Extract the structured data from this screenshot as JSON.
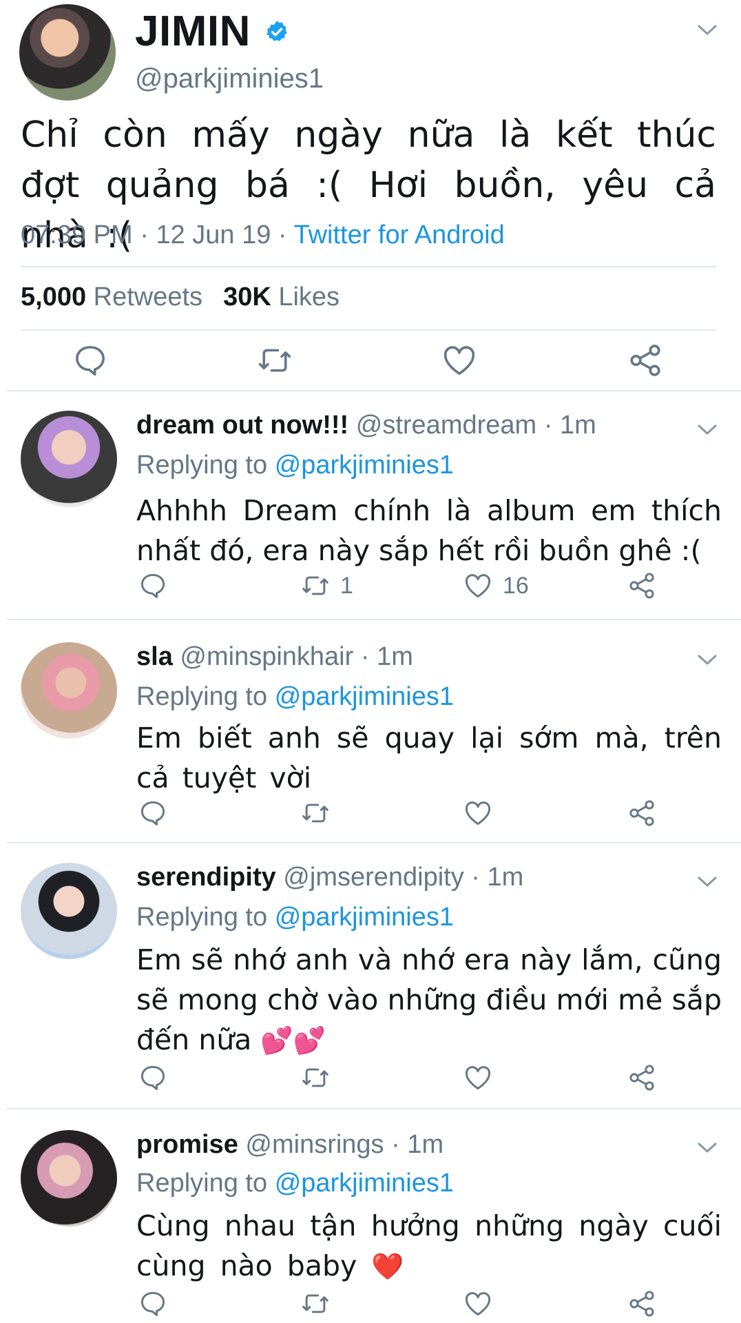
{
  "main_tweet": {
    "name": "JIMIN",
    "handle": "@parkjiminies1",
    "text": "Chỉ còn mấy ngày nữa là kết thúc đợt quảng bá :( Hơi buồn, yêu cả nhà :(",
    "time": "07:39 PM",
    "sep1": " · ",
    "date": "12 Jun 19",
    "sep2": " · ",
    "source": "Twitter for Android",
    "retweets_count": "5,000",
    "retweets_label": "Retweets",
    "likes_count": "30K",
    "likes_label": "Likes"
  },
  "replies": [
    {
      "display_name": "dream out now!!!",
      "handle": "@streamdream",
      "time": "· 1m",
      "replying_label": "Replying to",
      "replying_to": "@parkjiminies1",
      "text": "Ahhhh Dream chính là album em thích nhất đó, era này sắp hết rồi buồn ghê :(",
      "retweet_count": "1",
      "like_count": "16"
    },
    {
      "display_name": "sla",
      "handle": "@minspinkhair",
      "time": "· 1m",
      "replying_label": "Replying to",
      "replying_to": "@parkjiminies1",
      "text": "Em biết anh sẽ quay lại sớm mà, trên cả tuyệt vời",
      "retweet_count": "",
      "like_count": ""
    },
    {
      "display_name": "serendipity",
      "handle": "@jmserendipity",
      "time": "· 1m",
      "replying_label": "Replying to",
      "replying_to": "@parkjiminies1",
      "text": "Em sẽ nhớ anh và nhớ era này lắm, cũng sẽ mong chờ vào những điều mới mẻ sắp đến nữa",
      "emoji": "💕💕",
      "retweet_count": "",
      "like_count": ""
    },
    {
      "display_name": "promise",
      "handle": "@minsrings",
      "time": "· 1m",
      "replying_label": "Replying to",
      "replying_to": "@parkjiminies1",
      "text": "Cùng nhau tận hưởng những ngày cuối cùng nào baby",
      "emoji": "❤️",
      "retweet_count": "",
      "like_count": ""
    }
  ],
  "colors": {
    "accent": "#1b95e0",
    "secondary_text": "#657786",
    "divider": "#e1e8ed",
    "verified": "#1da1f2"
  },
  "icons": [
    "reply-icon",
    "retweet-icon",
    "like-icon",
    "share-icon",
    "chevron-down-icon",
    "verified-badge-icon"
  ]
}
